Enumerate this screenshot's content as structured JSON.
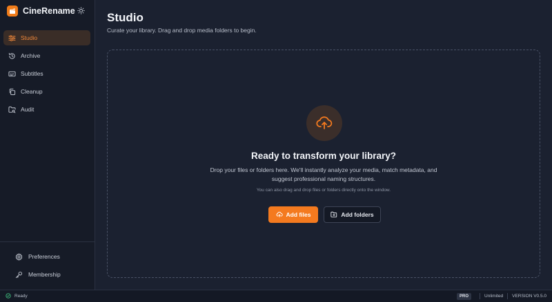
{
  "brand": {
    "name": "CineRename",
    "logo_icon": "clapperboard-icon",
    "accent": "#f07c1a"
  },
  "sidebar": {
    "items": [
      {
        "label": "Studio",
        "icon": "sliders-icon",
        "active": true
      },
      {
        "label": "Archive",
        "icon": "history-icon",
        "active": false
      },
      {
        "label": "Subtitles",
        "icon": "captions-icon",
        "active": false
      },
      {
        "label": "Cleanup",
        "icon": "copy-icon",
        "active": false
      },
      {
        "label": "Audit",
        "icon": "folder-search-icon",
        "active": false
      }
    ],
    "bottom_items": [
      {
        "label": "Preferences",
        "icon": "gear-icon"
      },
      {
        "label": "Membership",
        "icon": "key-icon"
      }
    ]
  },
  "main": {
    "title": "Studio",
    "subtitle": "Curate your library. Drag and drop media folders to begin.",
    "dropzone": {
      "heading": "Ready to transform your library?",
      "description": "Drop your files or folders here. We'll instantly analyze your media, match metadata, and suggest professional naming structures.",
      "hint": "You can also drag and drop files or folders directly onto the window.",
      "add_files_label": "Add files",
      "add_folders_label": "Add folders"
    }
  },
  "status": {
    "state": "Ready",
    "plan": "PRO",
    "quota": "Unlimited",
    "version": "VERSION V0.5.0"
  }
}
